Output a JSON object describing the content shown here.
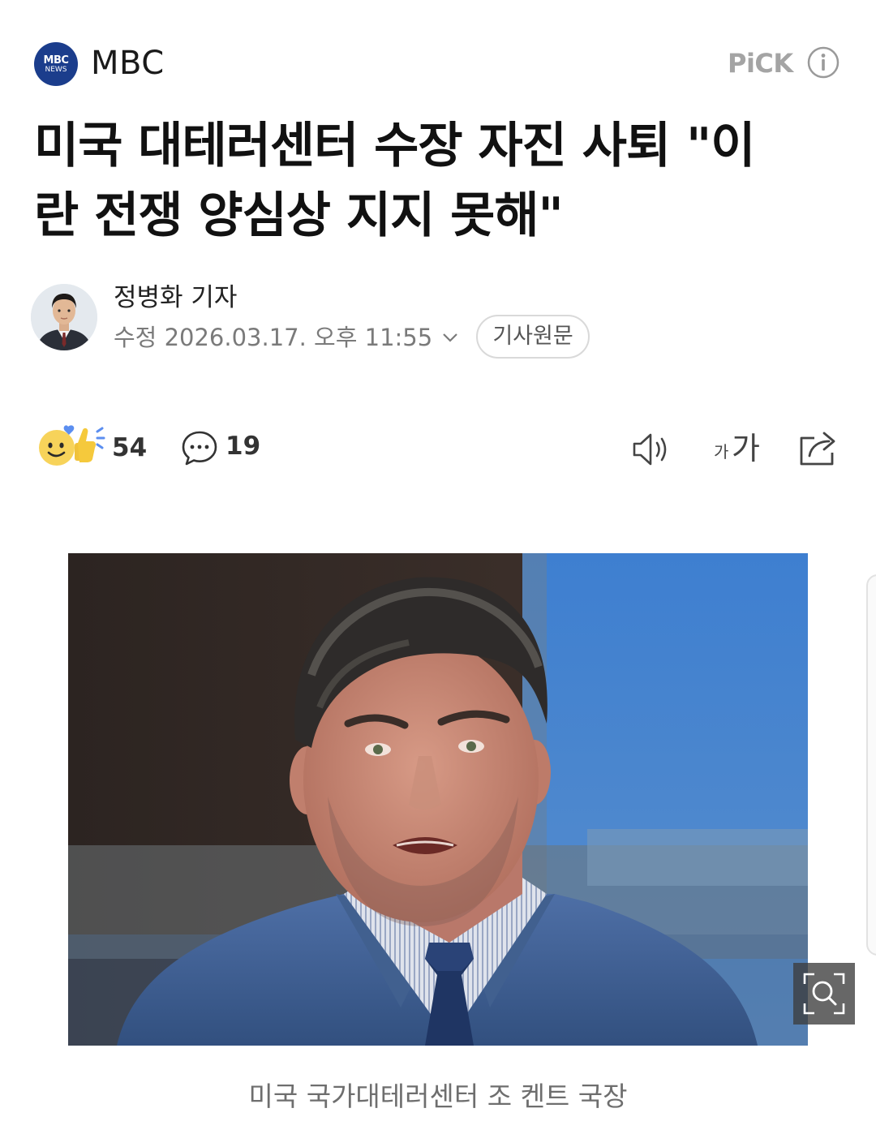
{
  "press": {
    "logo_line1": "MBC",
    "logo_line2": "NEWS",
    "name": "MBC",
    "pick": "PiCK",
    "brand_color": "#1b3d8c"
  },
  "article": {
    "headline_line1": "미국 대테러센터 수장 자진 사퇴 \"이",
    "headline_line2": "란 전쟁 양심상 지지 못해\"",
    "reporter": "정병화 기자",
    "date": "수정 2026.03.17. 오후 11:55",
    "original_link": "기사원문",
    "caption": "미국 국가대테러센터 조 켄트 국장"
  },
  "toolbar": {
    "reaction_count": "54",
    "comment_count": "19",
    "font_small": "가",
    "font_big": "가"
  },
  "icons": {
    "info": "info-icon",
    "reaction": "reaction-emoji-icon",
    "comment": "comment-bubble-icon",
    "speaker": "speaker-icon",
    "share": "share-icon",
    "zoom": "zoom-icon",
    "chevron": "chevron-down-icon"
  }
}
